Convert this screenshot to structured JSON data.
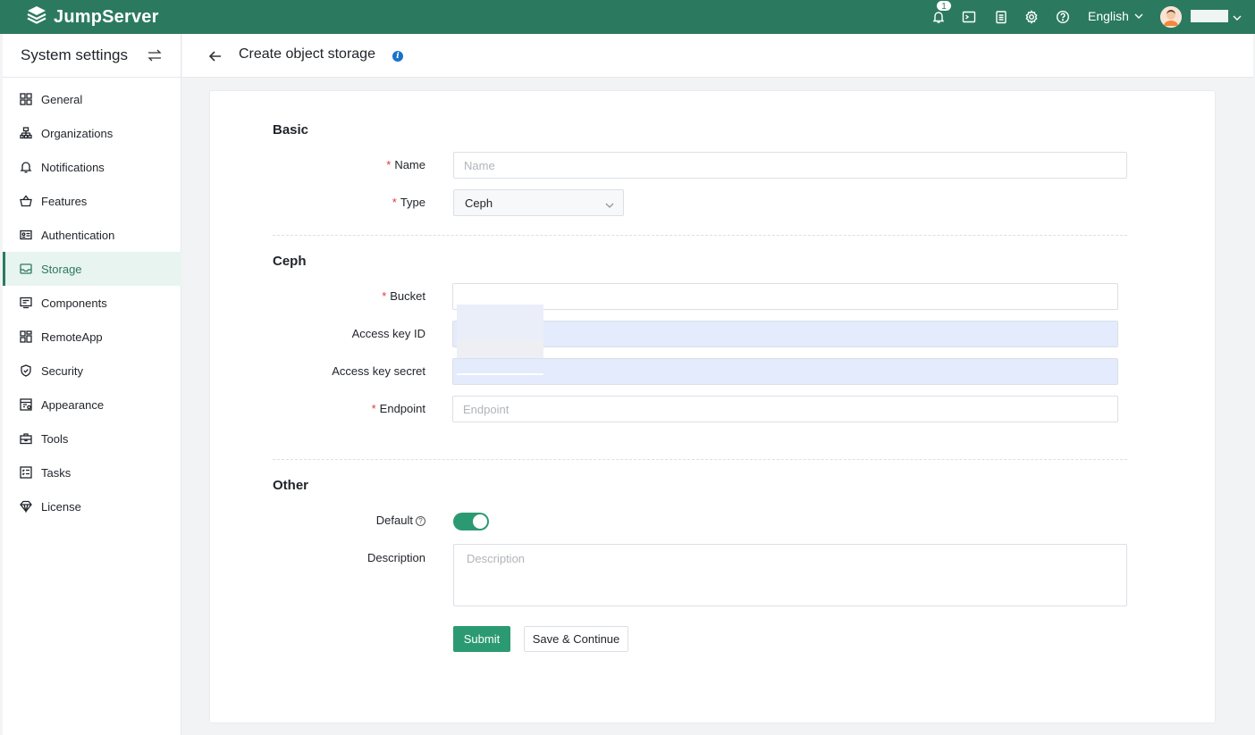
{
  "topbar": {
    "logo_text": "JumpServer",
    "notification_count": "1",
    "language": "English",
    "icons": [
      "bell-icon",
      "terminal-icon",
      "clipboard-icon",
      "gear-icon",
      "help-icon"
    ]
  },
  "sidebar": {
    "title": "System settings",
    "items": [
      {
        "label": "General",
        "icon": "grid-icon"
      },
      {
        "label": "Organizations",
        "icon": "org-icon"
      },
      {
        "label": "Notifications",
        "icon": "bell-icon"
      },
      {
        "label": "Features",
        "icon": "basket-icon"
      },
      {
        "label": "Authentication",
        "icon": "id-card-icon"
      },
      {
        "label": "Storage",
        "icon": "inbox-icon",
        "active": true
      },
      {
        "label": "Components",
        "icon": "monitor-icon"
      },
      {
        "label": "RemoteApp",
        "icon": "apps-icon"
      },
      {
        "label": "Security",
        "icon": "shield-icon"
      },
      {
        "label": "Appearance",
        "icon": "palette-icon"
      },
      {
        "label": "Tools",
        "icon": "toolbox-icon"
      },
      {
        "label": "Tasks",
        "icon": "tasks-icon"
      },
      {
        "label": "License",
        "icon": "diamond-icon"
      }
    ]
  },
  "page": {
    "title": "Create object storage"
  },
  "form": {
    "basic_title": "Basic",
    "name_label": "Name",
    "name_placeholder": "Name",
    "type_label": "Type",
    "type_value": "Ceph",
    "ceph_title": "Ceph",
    "bucket_label": "Bucket",
    "bucket_value": "",
    "access_key_id_label": "Access key ID",
    "access_key_secret_label": "Access key secret",
    "endpoint_label": "Endpoint",
    "endpoint_placeholder": "Endpoint",
    "other_title": "Other",
    "default_label": "Default",
    "default_on": true,
    "description_label": "Description",
    "description_placeholder": "Description",
    "submit_label": "Submit",
    "save_continue_label": "Save & Continue"
  },
  "colors": {
    "topbar": "#2b7a60",
    "accent": "#2b9a72",
    "required": "#e0383e",
    "info": "#1a73c9"
  }
}
